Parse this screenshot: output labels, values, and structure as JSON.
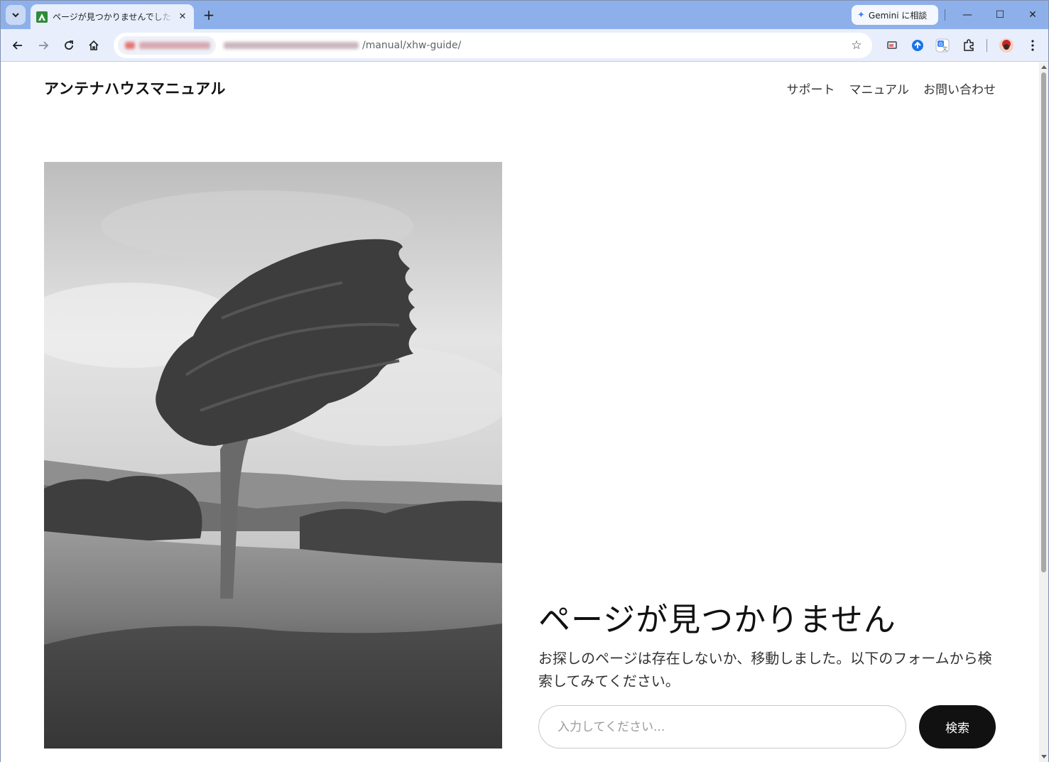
{
  "browser": {
    "tab": {
      "title": "ページが見つかりませんでした – アンテナハウスマニュアル",
      "close_glyph": "✕"
    },
    "new_tab_glyph": "+",
    "gemini_label": "Gemini に相談",
    "url_path": "/manual/xhw-guide/",
    "window_controls": {
      "minimize": "—",
      "maximize": "☐",
      "close": "✕"
    },
    "icons": {
      "back": "arrow-left-icon",
      "forward": "arrow-right-icon",
      "reload": "reload-icon",
      "home": "home-icon",
      "bookmark": "star-icon",
      "extensions": "puzzle-icon",
      "menu": "kebab-menu-icon"
    }
  },
  "site": {
    "title": "アンテナハウスマニュアル",
    "nav": [
      "サポート",
      "マニュアル",
      "お問い合わせ"
    ]
  },
  "error": {
    "heading": "ページが見つかりません",
    "description": "お探しのページは存在しないか、移動しました。以下のフォームから検索してみてください。",
    "search_placeholder": "入力してください...",
    "search_button": "検索"
  },
  "colors": {
    "tabstrip": "#8eb0ea",
    "toolbar": "#e8eefc",
    "button_bg": "#111111",
    "text": "#111111"
  }
}
